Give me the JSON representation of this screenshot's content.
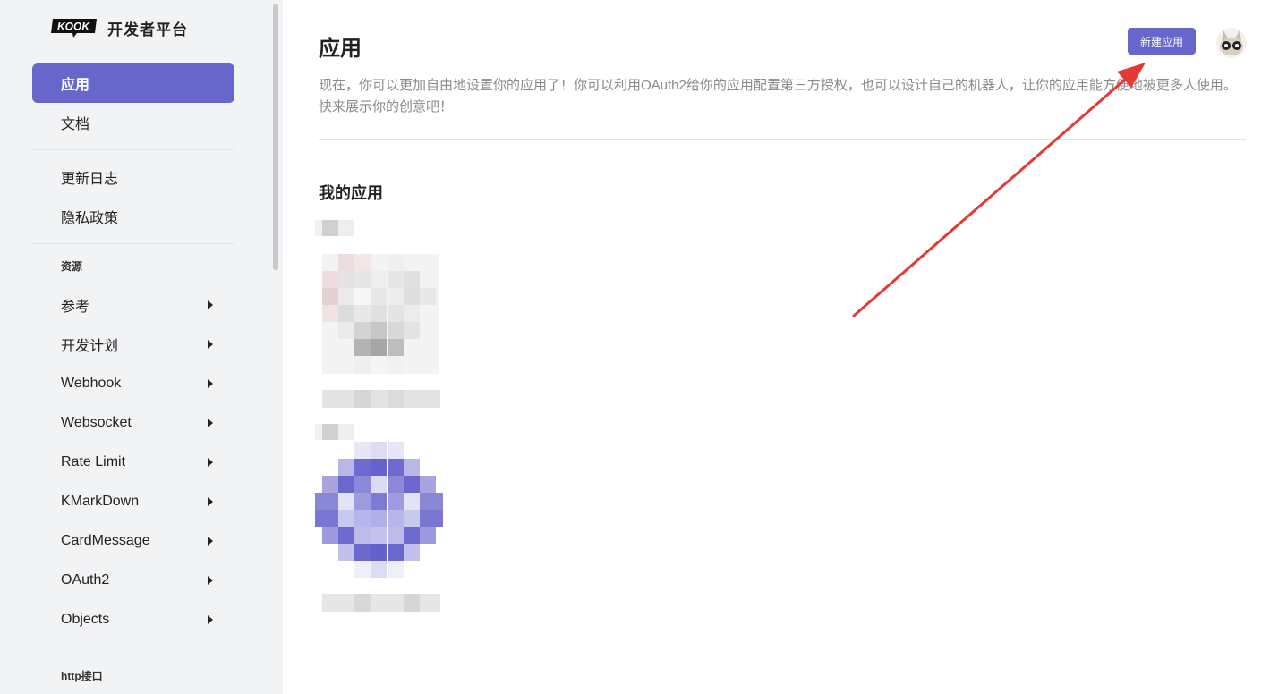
{
  "brand": {
    "logo_text": "KOOK",
    "name": "开发者平台"
  },
  "sidebar": {
    "items_top": [
      {
        "label": "应用",
        "active": true
      },
      {
        "label": "文档",
        "active": false
      }
    ],
    "items_mid": [
      {
        "label": "更新日志"
      },
      {
        "label": "隐私政策"
      }
    ],
    "section_resources": "资源",
    "resources": [
      {
        "label": "参考"
      },
      {
        "label": "开发计划"
      },
      {
        "label": "Webhook"
      },
      {
        "label": "Websocket"
      },
      {
        "label": "Rate Limit"
      },
      {
        "label": "KMarkDown"
      },
      {
        "label": "CardMessage"
      },
      {
        "label": "OAuth2"
      },
      {
        "label": "Objects"
      }
    ],
    "section_http": "http接口"
  },
  "main": {
    "title": "应用",
    "description": "现在，你可以更加自由地设置你的应用了！你可以利用OAuth2给你的应用配置第三方授权，也可以设计自己的机器人，让你的应用能方便地被更多人使用。快来展示你的创意吧！",
    "new_app_button": "新建应用",
    "my_apps_title": "我的应用",
    "apps": [
      {
        "name": "",
        "icon": "app-icon-pixelated-gray"
      },
      {
        "name": "",
        "icon": "app-icon-pixelated-purple"
      }
    ]
  },
  "colors": {
    "accent": "#6766cb",
    "sidebar_bg": "#f2f3f5",
    "annotation_arrow": "#e53935"
  }
}
